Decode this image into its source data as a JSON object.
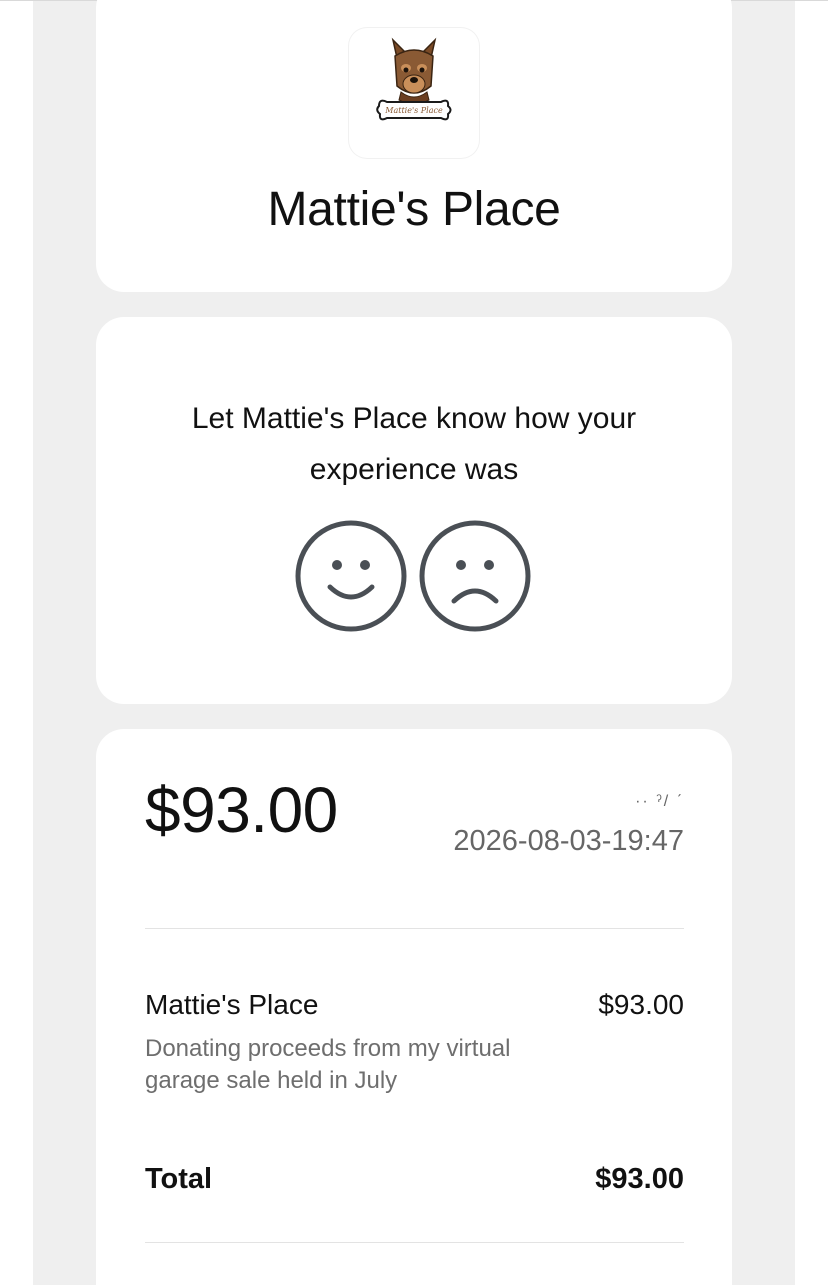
{
  "header": {
    "merchant_name": "Mattie's Place",
    "logo_text": "Mattie's Place"
  },
  "feedback": {
    "prompt": "Let Mattie's Place know how your experience was",
    "happy_icon": "smiley-face-icon",
    "sad_icon": "frowny-face-icon"
  },
  "receipt": {
    "amount": "$93.00",
    "date_marks": "··   ˀ/ ˊ",
    "datetime": "2026-08-03-19:47",
    "line_items": [
      {
        "name": "Mattie's Place",
        "price": "$93.00",
        "description": "Donating proceeds from my virtual garage sale held in July"
      }
    ],
    "total_label": "Total",
    "total_value": "$93.00"
  },
  "colors": {
    "background": "#efefef",
    "card": "#ffffff",
    "text_primary": "#111111",
    "text_secondary": "#6e6e6e",
    "icon_stroke": "#4a4f55"
  }
}
